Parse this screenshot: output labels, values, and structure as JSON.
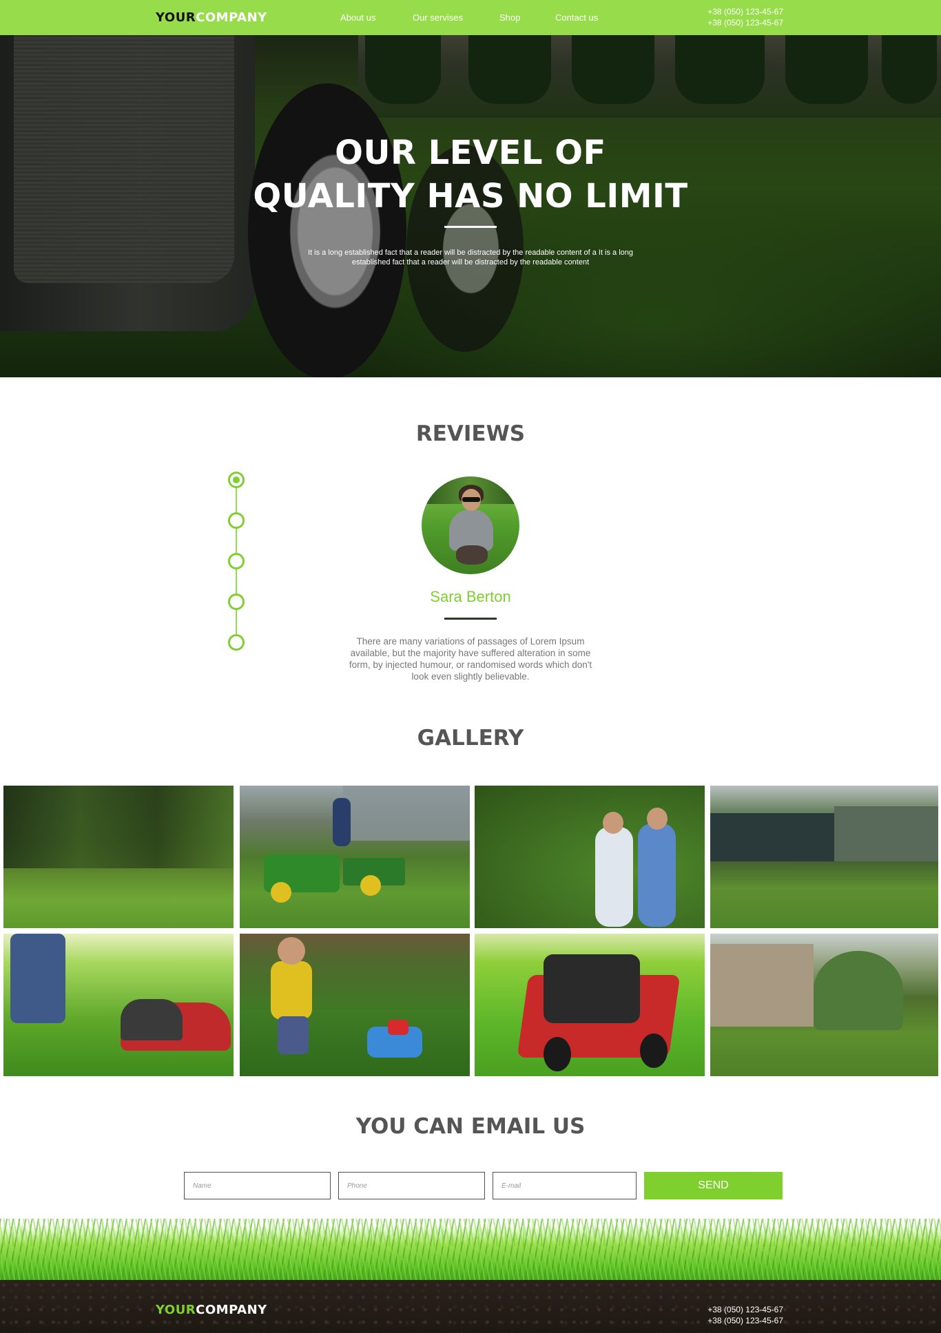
{
  "header": {
    "logo_part1": "YOUR",
    "logo_part2": "COMPANY",
    "nav": [
      "About us",
      "Our servises",
      "Shop",
      "Contact us"
    ],
    "phone1": "+38 (050) 123-45-67",
    "phone2": "+38 (050) 123-45-67"
  },
  "hero": {
    "title_line1": "OUR LEVEL OF",
    "title_line2": "QUALITY HAS NO LIMIT",
    "text": "It is a long established fact that a reader will be distracted by the readable content of a It is a long established fact that a reader will be distracted by the readable content"
  },
  "reviews": {
    "title": "REVIEWS",
    "active_index": 0,
    "count": 5,
    "name": "Sara Berton",
    "text": "There are many variations of passages of Lorem Ipsum available, but the majority have suffered alteration in some form, by injected humour, or randomised words which don't look even slightly believable."
  },
  "gallery": {
    "title": "GALLERY"
  },
  "contact": {
    "title": "YOU CAN EMAIL US",
    "name_placeholder": "Name",
    "phone_placeholder": "Phone",
    "email_placeholder": "E-mail",
    "send_label": "SEND"
  },
  "footer": {
    "logo_part1": "YOUR",
    "logo_part2": "COMPANY",
    "phone1": "+38 (050) 123-45-67",
    "phone2": "+38 (050) 123-45-67"
  },
  "colors": {
    "accent": "#7fcf2e",
    "nav_bg": "#97dd4b",
    "heading": "#555555",
    "footer_bg": "#1e1813"
  }
}
